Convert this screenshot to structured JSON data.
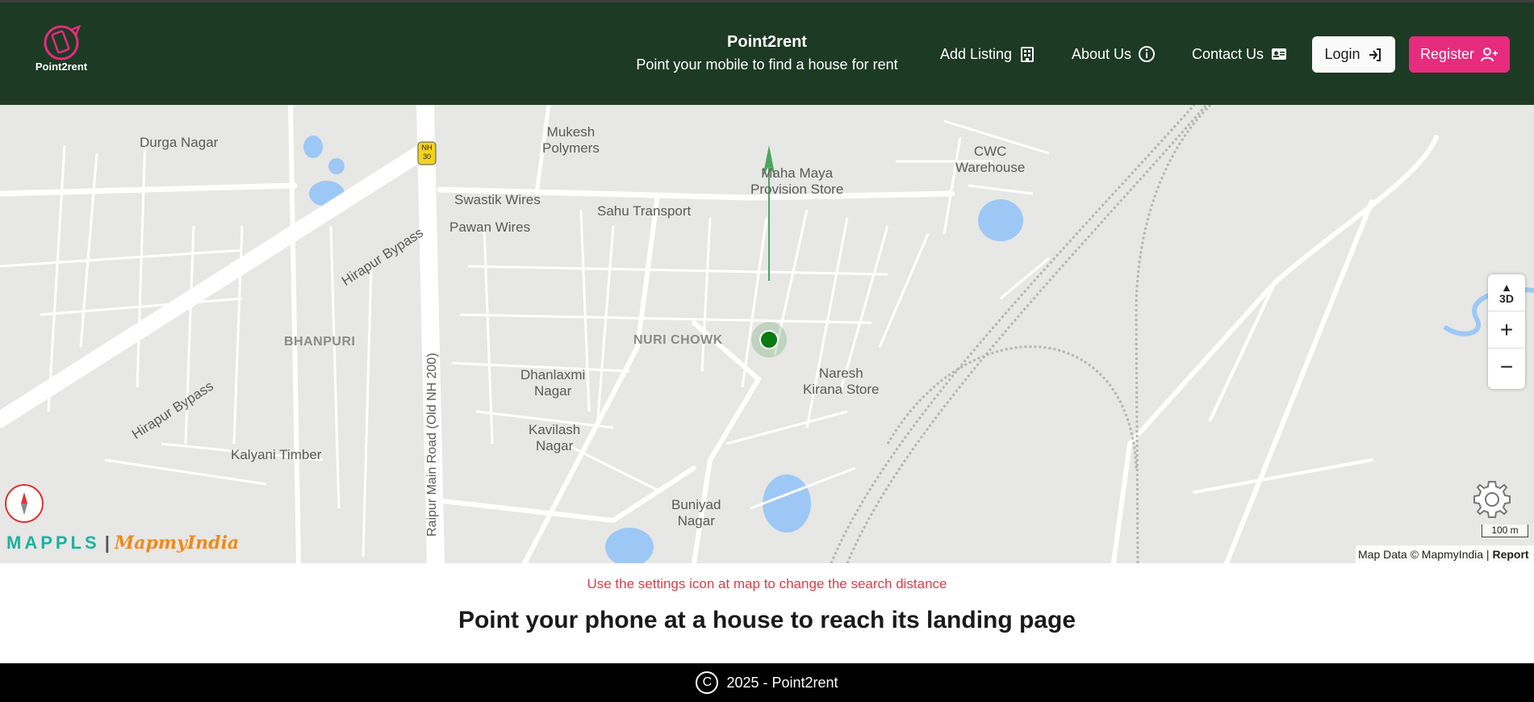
{
  "header": {
    "logo_text": "Point2rent",
    "brand_title": "Point2rent",
    "brand_subtitle": "Point your mobile to find a house for rent",
    "nav": {
      "add_listing": "Add Listing",
      "about_us": "About Us",
      "contact_us": "Contact Us"
    },
    "login_label": "Login",
    "register_label": "Register"
  },
  "map": {
    "labels": {
      "durga_nagar": "Durga Nagar",
      "mukesh_polymers": "Mukesh\nPolymers",
      "nh30": "NH\n30",
      "swastik_wires": "Swastik Wires",
      "pawan_wires": "Pawan Wires",
      "sahu_transport": "Sahu Transport",
      "maha_maya": "Maha Maya\nProvision Store",
      "cwc_warehouse": "CWC\nWarehouse",
      "hirapur_bypass_1": "Hirapur Bypass",
      "hirapur_bypass_2": "Hirapur Bypass",
      "bhanpuri": "BHANPURI",
      "nuri_chowk": "NURI CHOWK",
      "dhanlaxmi_nagar": "Dhanlaxmi\nNagar",
      "naresh_kirana": "Naresh\nKirana Store",
      "kavilash_nagar": "Kavilash\nNagar",
      "kalyani_timber": "Kalyani Timber",
      "raipur_main_road": "Raipur Main Road (Old NH 200)",
      "buniyad_nagar": "Buniyad\nNagar"
    },
    "controls": {
      "three_d": "3D",
      "zoom_in": "+",
      "zoom_out": "−"
    },
    "scale_label": "100 m",
    "attribution_text": "Map Data © MapmyIndia |",
    "report_link": "Report",
    "brand_mappls": "MAPPLS",
    "brand_separator": "|",
    "brand_mapmyindia": "MapmyIndia"
  },
  "note": "Use the settings icon at map to change the search distance",
  "heading": "Point your phone at a house to reach its landing page",
  "footer": {
    "text": "2025 - Point2rent",
    "copyright_symbol": "C"
  },
  "colors": {
    "header_bg": "#1d3a24",
    "register_bg": "#e72b7d",
    "note_color": "#e03b46",
    "location_dot": "#0a7a12"
  }
}
